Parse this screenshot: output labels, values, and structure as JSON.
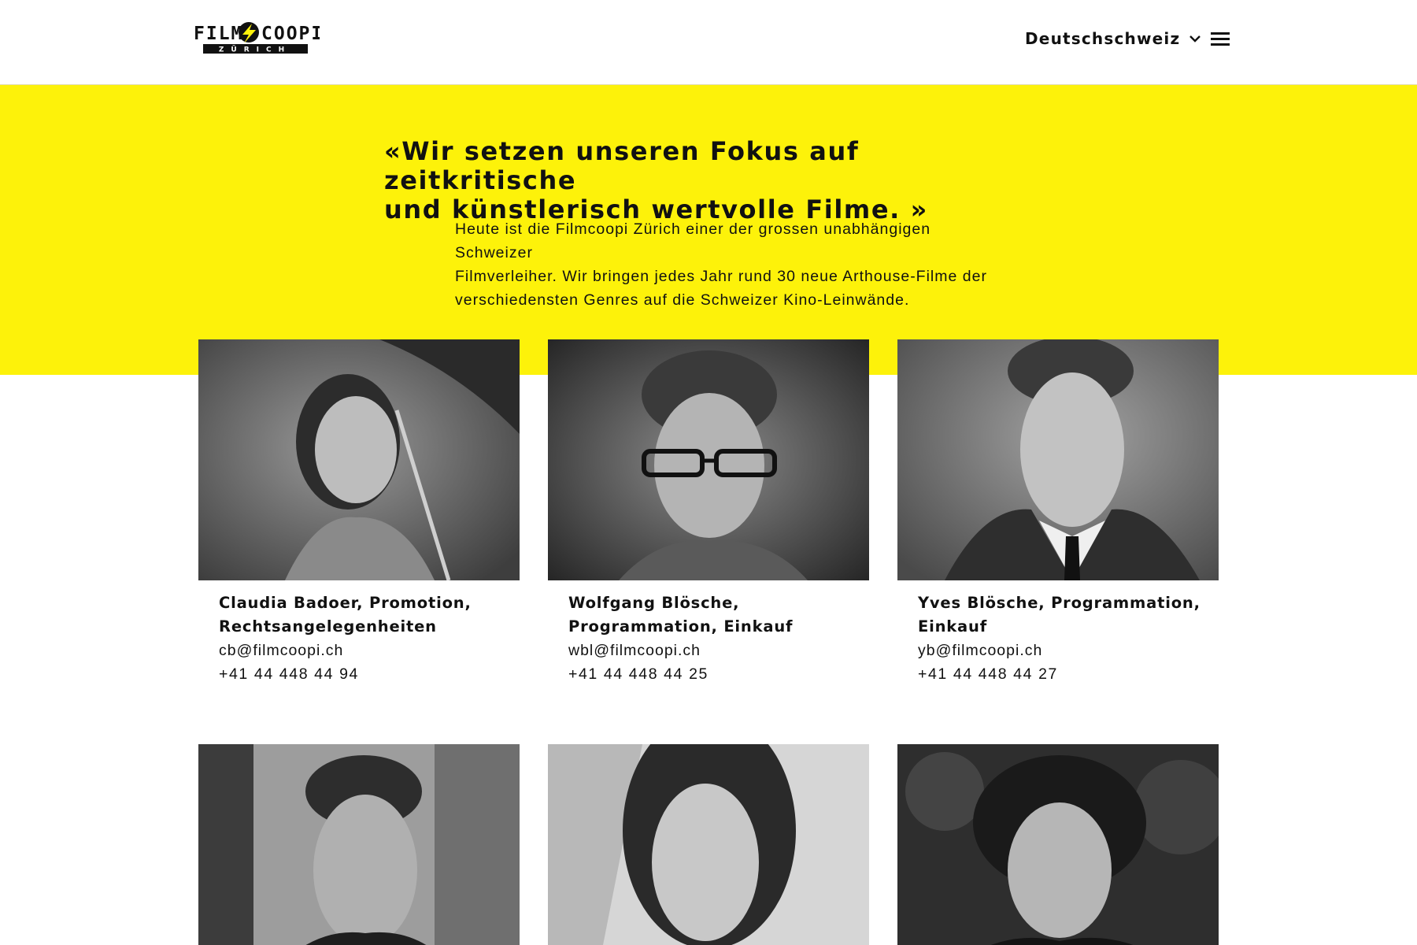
{
  "colors": {
    "accent": "#fdf20a",
    "text": "#111111",
    "background": "#ffffff"
  },
  "header": {
    "logo": {
      "top_text": "FILM COOPI",
      "sub_text": "ZÜRICH",
      "icon": "lightning-icon"
    },
    "language": {
      "label": "Deutschschweiz",
      "icon": "chevron-down-icon"
    },
    "menu": {
      "icon": "hamburger-menu-icon"
    }
  },
  "intro": {
    "quote_line1": "«Wir setzen unseren Fokus auf zeitkritische",
    "quote_line2": "und künstlerisch wertvolle Filme. »",
    "lead_line1": "Heute ist die Filmcoopi Zürich einer der grossen unabhängigen Schweizer",
    "lead_line2": "Filmverleiher. Wir bringen jedes Jahr rund 30 neue Arthouse-Filme der",
    "lead_line3": "verschiedensten Genres auf die Schweizer Kino-Leinwände."
  },
  "team": [
    {
      "name_line1": "Claudia Badoer, Promotion,",
      "name_line2": "Rechtsangelegenheiten",
      "email": "cb@filmcoopi.ch",
      "phone": "+41 44 448 44 94"
    },
    {
      "name_line1": "Wolfgang Blösche,",
      "name_line2": "Programmation, Einkauf",
      "email": "wbl@filmcoopi.ch",
      "phone": "+41 44 448 44 25"
    },
    {
      "name_line1": "Yves Blösche, Programmation,",
      "name_line2": "Einkauf",
      "email": "yb@filmcoopi.ch",
      "phone": "+41 44 448 44 27"
    },
    {
      "name_line1": "",
      "name_line2": "",
      "email": "",
      "phone": ""
    },
    {
      "name_line1": "",
      "name_line2": "",
      "email": "",
      "phone": ""
    },
    {
      "name_line1": "",
      "name_line2": "",
      "email": "",
      "phone": ""
    }
  ]
}
